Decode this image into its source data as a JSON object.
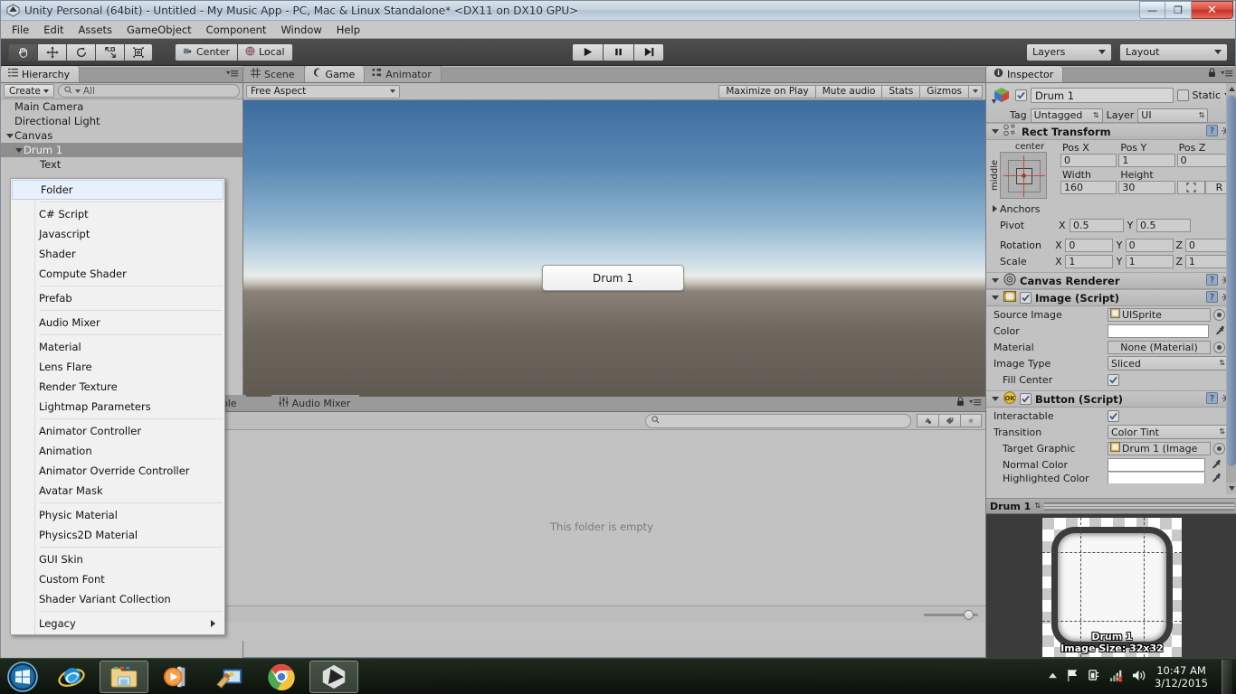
{
  "window": {
    "title": "Unity Personal (64bit) - Untitled - My Music App - PC, Mac & Linux Standalone* <DX11 on DX10 GPU>",
    "minimize_label": "—",
    "maximize_label": "❐",
    "close_label": "✕"
  },
  "menubar": {
    "items": [
      "File",
      "Edit",
      "Assets",
      "GameObject",
      "Component",
      "Window",
      "Help"
    ]
  },
  "toolbar": {
    "tools": [
      {
        "name": "hand-tool",
        "active": true
      },
      {
        "name": "move-tool",
        "active": false
      },
      {
        "name": "rotate-tool",
        "active": false
      },
      {
        "name": "scale-tool",
        "active": false
      },
      {
        "name": "rect-tool",
        "active": false
      }
    ],
    "pivot_label": "Center",
    "space_label": "Local",
    "play_label": "Play",
    "pause_label": "Pause",
    "step_label": "Step",
    "layers_label": "Layers",
    "layout_label": "Layout"
  },
  "hierarchy": {
    "tab_label": "Hierarchy",
    "create_label": "Create",
    "search_placeholder": "All",
    "items": [
      {
        "label": "Main Camera",
        "depth": 1,
        "arrow": "none",
        "selected": false
      },
      {
        "label": "Directional Light",
        "depth": 1,
        "arrow": "none",
        "selected": false
      },
      {
        "label": "Canvas",
        "depth": 0,
        "arrow": "down",
        "selected": false
      },
      {
        "label": "Drum 1",
        "depth": 1,
        "arrow": "down",
        "selected": true
      },
      {
        "label": "Text",
        "depth": 2,
        "arrow": "none",
        "selected": false
      }
    ]
  },
  "context_menu": {
    "groups": [
      [
        {
          "label": "Folder",
          "highlight": true,
          "submenu": false
        }
      ],
      [
        {
          "label": "C# Script",
          "highlight": false,
          "submenu": false
        },
        {
          "label": "Javascript",
          "highlight": false,
          "submenu": false
        },
        {
          "label": "Shader",
          "highlight": false,
          "submenu": false
        },
        {
          "label": "Compute Shader",
          "highlight": false,
          "submenu": false
        }
      ],
      [
        {
          "label": "Prefab",
          "highlight": false,
          "submenu": false
        }
      ],
      [
        {
          "label": "Audio Mixer",
          "highlight": false,
          "submenu": false
        }
      ],
      [
        {
          "label": "Material",
          "highlight": false,
          "submenu": false
        },
        {
          "label": "Lens Flare",
          "highlight": false,
          "submenu": false
        },
        {
          "label": "Render Texture",
          "highlight": false,
          "submenu": false
        },
        {
          "label": "Lightmap Parameters",
          "highlight": false,
          "submenu": false
        }
      ],
      [
        {
          "label": "Animator Controller",
          "highlight": false,
          "submenu": false
        },
        {
          "label": "Animation",
          "highlight": false,
          "submenu": false
        },
        {
          "label": "Animator Override Controller",
          "highlight": false,
          "submenu": false
        },
        {
          "label": "Avatar Mask",
          "highlight": false,
          "submenu": false
        }
      ],
      [
        {
          "label": "Physic Material",
          "highlight": false,
          "submenu": false
        },
        {
          "label": "Physics2D Material",
          "highlight": false,
          "submenu": false
        }
      ],
      [
        {
          "label": "GUI Skin",
          "highlight": false,
          "submenu": false
        },
        {
          "label": "Custom Font",
          "highlight": false,
          "submenu": false
        },
        {
          "label": "Shader Variant Collection",
          "highlight": false,
          "submenu": false
        }
      ],
      [
        {
          "label": "Legacy",
          "highlight": false,
          "submenu": true
        }
      ]
    ]
  },
  "center_tabs": [
    {
      "label": "Scene",
      "active": false,
      "icon": "grid-icon"
    },
    {
      "label": "Game",
      "active": true,
      "icon": "gamepad-icon"
    },
    {
      "label": "Animator",
      "active": false,
      "icon": "animator-icon"
    }
  ],
  "gameview": {
    "aspect_label": "Free Aspect",
    "buttons": [
      "Maximize on Play",
      "Mute audio",
      "Stats",
      "Gizmos"
    ],
    "button_drum_label": "Drum 1"
  },
  "project_panel": {
    "tabs": [
      {
        "label": "ole",
        "active": false,
        "icon": "console-icon"
      },
      {
        "label": "Audio Mixer",
        "active": false,
        "icon": "mixer-icon"
      }
    ],
    "search_placeholder": "",
    "empty_message": "This folder is empty"
  },
  "inspector": {
    "tab_label": "Inspector",
    "object_name": "Drum 1",
    "static_label": "Static",
    "tag_label": "Tag",
    "tag_value": "Untagged",
    "layer_label": "Layer",
    "layer_value": "UI",
    "rect_transform": {
      "title": "Rect Transform",
      "anchor_h_label": "center",
      "anchor_v_label": "middle",
      "pos_x_label": "Pos X",
      "pos_x": "0",
      "pos_y_label": "Pos Y",
      "pos_y": "1",
      "pos_z_label": "Pos Z",
      "pos_z": "0",
      "width_label": "Width",
      "width": "160",
      "height_label": "Height",
      "height": "30",
      "blueprint_label": "R",
      "anchors_label": "Anchors",
      "pivot_label": "Pivot",
      "pivot_x": "0.5",
      "pivot_y": "0.5",
      "rotation_label": "Rotation",
      "rot_x": "0",
      "rot_y": "0",
      "rot_z": "0",
      "scale_label": "Scale",
      "scale_x": "1",
      "scale_y": "1",
      "scale_z": "1",
      "axis_x": "X",
      "axis_y": "Y",
      "axis_z": "Z"
    },
    "canvas_renderer": {
      "title": "Canvas Renderer"
    },
    "image_script": {
      "title": "Image (Script)",
      "source_image_label": "Source Image",
      "source_image_value": "UISprite",
      "color_label": "Color",
      "color_value": "#FFFFFF",
      "material_label": "Material",
      "material_value": "None (Material)",
      "image_type_label": "Image Type",
      "image_type_value": "Sliced",
      "fill_center_label": "Fill Center"
    },
    "button_script": {
      "title": "Button (Script)",
      "interactable_label": "Interactable",
      "transition_label": "Transition",
      "transition_value": "Color Tint",
      "target_graphic_label": "Target Graphic",
      "target_graphic_value": "Drum 1 (Image",
      "normal_color_label": "Normal Color",
      "normal_color_value": "#FFFFFF",
      "highlighted_color_label": "Highlighted Color"
    },
    "preview": {
      "title": "Drum 1",
      "caption_line1": "Drum 1",
      "caption_line2": "Image Size: 32x32"
    }
  },
  "taskbar": {
    "items": [
      {
        "name": "start-orb",
        "label": "Start"
      },
      {
        "name": "internet-explorer",
        "label": "Internet Explorer"
      },
      {
        "name": "file-explorer",
        "label": "File Explorer"
      },
      {
        "name": "windows-media-player",
        "label": "Windows Media Player"
      },
      {
        "name": "paint",
        "label": "Paint"
      },
      {
        "name": "google-chrome",
        "label": "Google Chrome"
      },
      {
        "name": "unity-editor",
        "label": "Unity"
      }
    ],
    "time": "10:47 AM",
    "date": "3/12/2015"
  }
}
